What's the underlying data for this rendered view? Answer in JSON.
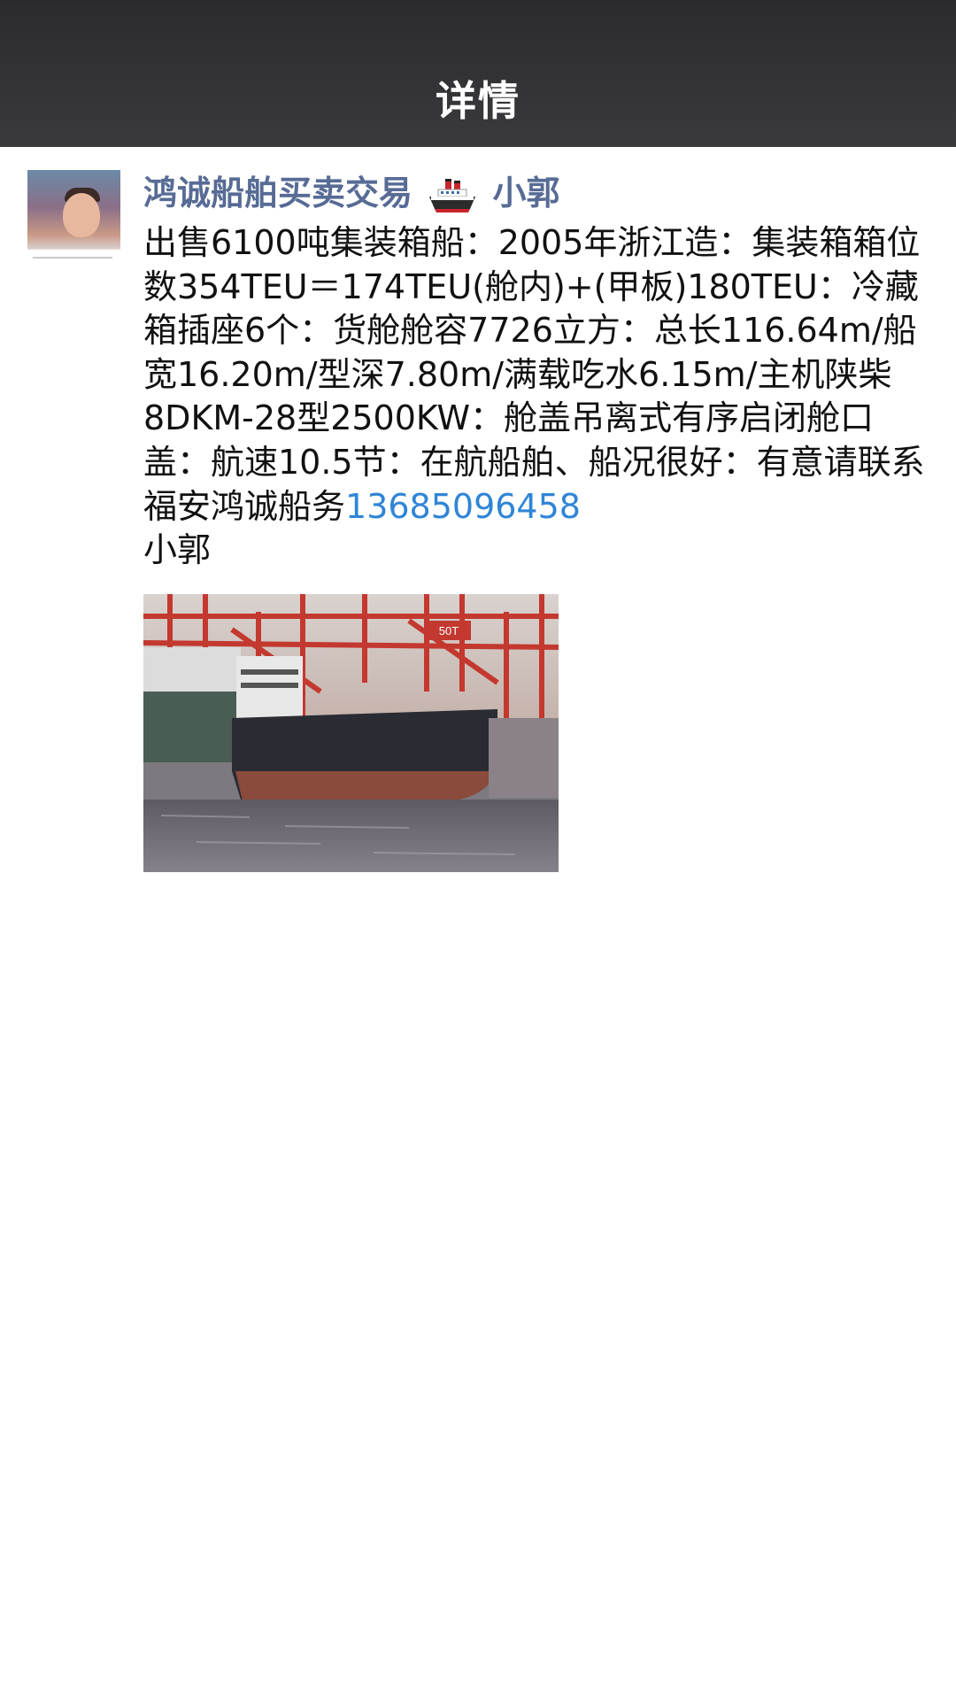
{
  "nav": {
    "title": "详情"
  },
  "post": {
    "author": {
      "name_prefix": "鸿诚船舶买卖交易",
      "name_suffix": "小郭",
      "badge_icon": "ship-emoji-icon"
    },
    "content": {
      "text": "出售6100吨集装箱船：2005年浙江造：集装箱箱位数354TEU＝174TEU(舱内)+(甲板)180TEU：冷藏箱插座6个：货舱舱容7726立方：总长116.64m/船宽16.20m/型深7.80m/满载吃水6.15m/主机陕柴8DKM-28型2500KW：舱盖吊离式有序启闭舱口盖：航速10.5节：在航船舶、船况很好：有意请联系福安鸿诚船务",
      "phone": "13685096458",
      "signature": "小郭"
    },
    "photo": {
      "description_icon": "ship-photo",
      "crane_label": "50T"
    }
  },
  "colors": {
    "nav_bg": "#333335",
    "author_name": "#576b95",
    "link": "#2f85d6",
    "text": "#111111"
  }
}
